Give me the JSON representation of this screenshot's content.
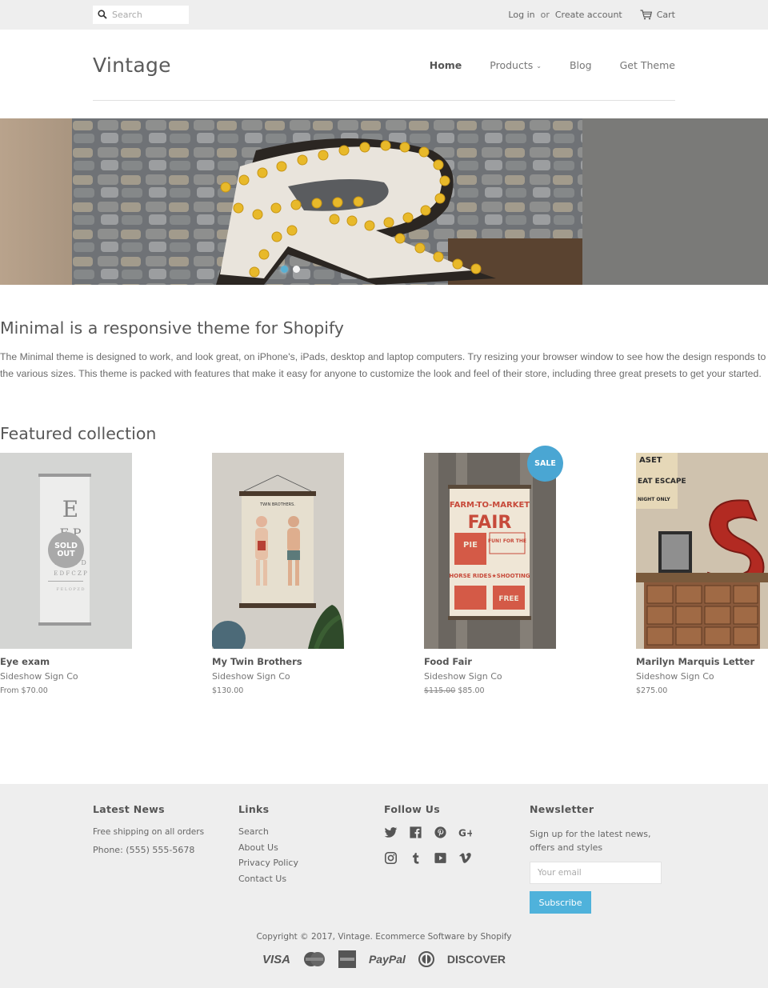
{
  "topbar": {
    "search_placeholder": "Search",
    "login": "Log in",
    "or": "or",
    "create_account": "Create account",
    "cart": "Cart"
  },
  "header": {
    "logo": "Vintage",
    "nav": [
      {
        "label": "Home",
        "active": true
      },
      {
        "label": "Products",
        "has_dropdown": true,
        "chevron": "⌄"
      },
      {
        "label": "Blog"
      },
      {
        "label": "Get Theme"
      }
    ]
  },
  "hero": {
    "slides": 2,
    "active_slide": 1,
    "accent": "#59b0d3"
  },
  "intro": {
    "title": "Minimal is a responsive theme for Shopify",
    "text": "The Minimal theme is designed to work, and look great, on iPhone's, iPads, desktop and laptop computers. Try resizing your browser window to see how the design responds to the various sizes. This theme is packed with features that make it easy for anyone to customize the look and feel of their store, including three great presets to get your started."
  },
  "featured": {
    "title": "Featured collection",
    "products": [
      {
        "name": "Eye exam",
        "vendor": "Sideshow Sign Co",
        "price": "From $70.00",
        "badge": "SOLD OUT"
      },
      {
        "name": "My Twin Brothers",
        "vendor": "Sideshow Sign Co",
        "price": "$130.00"
      },
      {
        "name": "Food Fair",
        "vendor": "Sideshow Sign Co",
        "compare_price": "$115.00",
        "price": "$85.00",
        "badge": "SALE"
      },
      {
        "name": "Marilyn Marquis Letter",
        "vendor": "Sideshow Sign Co",
        "price": "$275.00"
      }
    ]
  },
  "footer": {
    "latest_news": {
      "title": "Latest News",
      "line1": "Free shipping on all orders",
      "line2": "Phone: (555) 555-5678"
    },
    "links": {
      "title": "Links",
      "items": [
        "Search",
        "About Us",
        "Privacy Policy",
        "Contact Us"
      ]
    },
    "follow": {
      "title": "Follow Us",
      "icons": [
        "twitter",
        "facebook",
        "pinterest",
        "google-plus",
        "instagram",
        "tumblr",
        "youtube",
        "vimeo"
      ]
    },
    "newsletter": {
      "title": "Newsletter",
      "text": "Sign up for the latest news, offers and styles",
      "placeholder": "Your email",
      "button": "Subscribe"
    },
    "copyright": "Copyright © 2017, Vintage. Ecommerce Software by Shopify",
    "payments": {
      "visa": "VISA",
      "mastercard": "MasterCard",
      "amex": "AMEX",
      "paypal": "PayPal",
      "diners": "Diners",
      "discover": "DISCOVER"
    }
  },
  "colors": {
    "accent": "#4fb2db",
    "sale_badge": "#4aa6d3",
    "soldout_badge": "#a9a9a9",
    "topbar_bg": "#eeeeee",
    "footer_bg": "#eeeeee"
  }
}
